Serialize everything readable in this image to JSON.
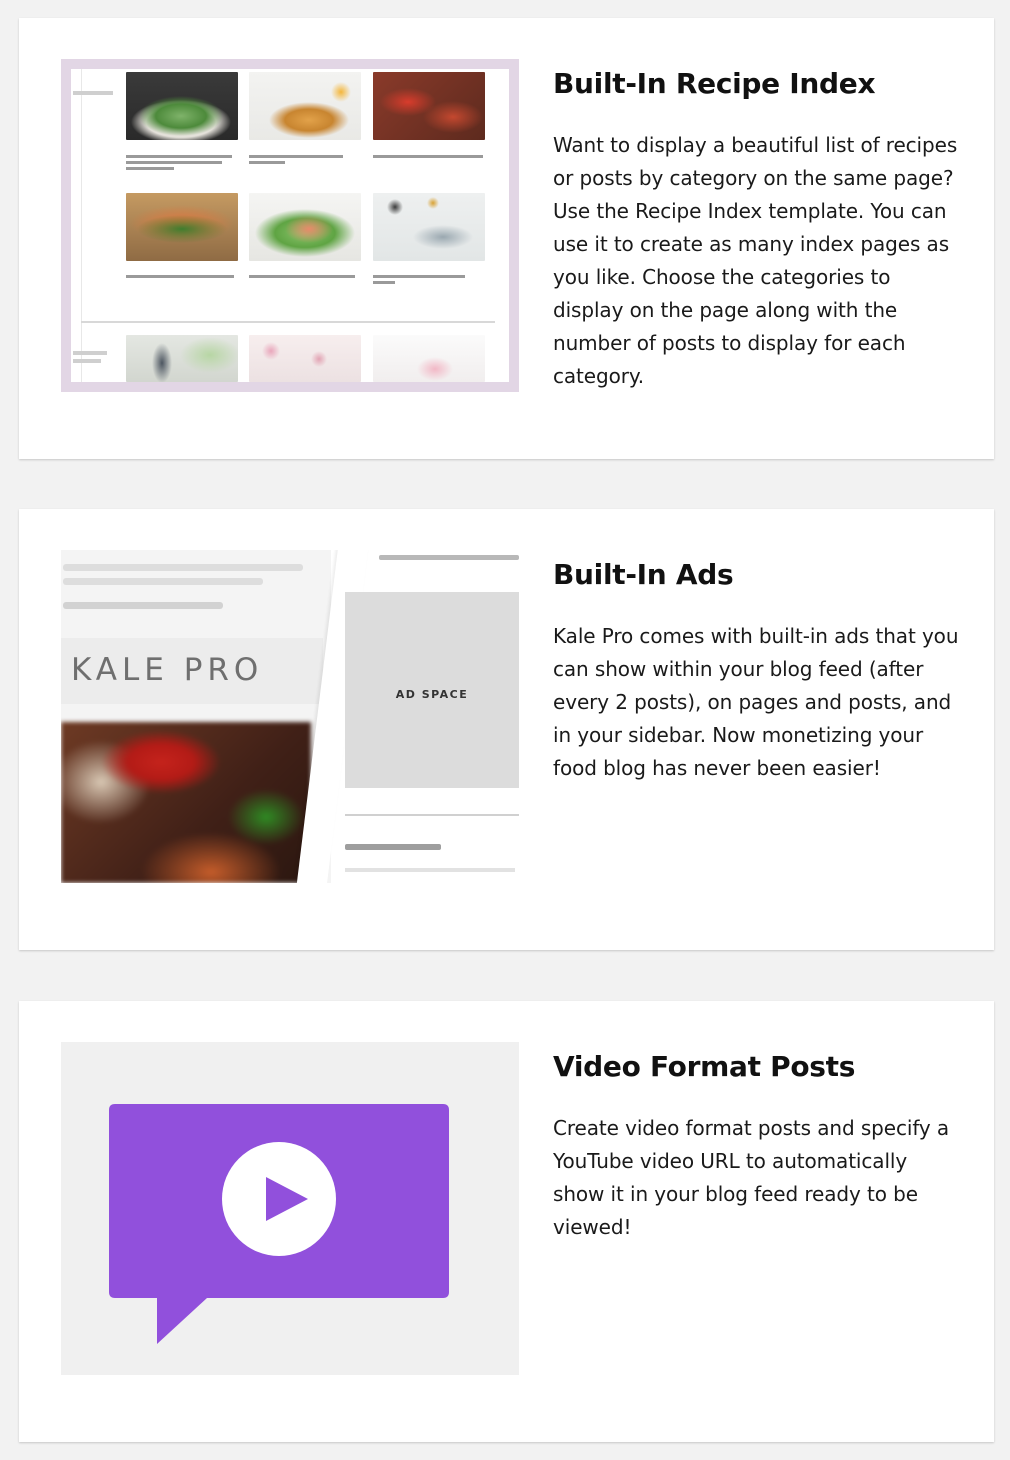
{
  "features": [
    {
      "title": "Built-In Recipe Index",
      "description": "Want to display a beautiful list of recipes or posts by category on the same page? Use the Recipe Index template. You can use it to create as many index pages as you like. Choose the categories to display on the page along with the number of posts to display for each category."
    },
    {
      "title": "Built-In Ads",
      "description": "Kale Pro comes with built-in ads that you can show within your blog feed (after every 2 posts), on pages and posts, and in your sidebar. Now monetizing your food blog has never been easier!",
      "image": {
        "brand": "KALE PRO",
        "ad_label": "AD SPACE"
      }
    },
    {
      "title": "Video Format Posts",
      "description": "Create video format posts and specify a YouTube video URL to automatically show it in your blog feed ready to be viewed!",
      "image": {
        "icon": "video-play-icon",
        "icon_color": "#9150dc"
      }
    }
  ],
  "colors": {
    "page_background": "#f2f2f2",
    "card_background": "#ffffff",
    "accent_purple": "#9150dc",
    "recipe_frame": "#e2d6e5"
  }
}
